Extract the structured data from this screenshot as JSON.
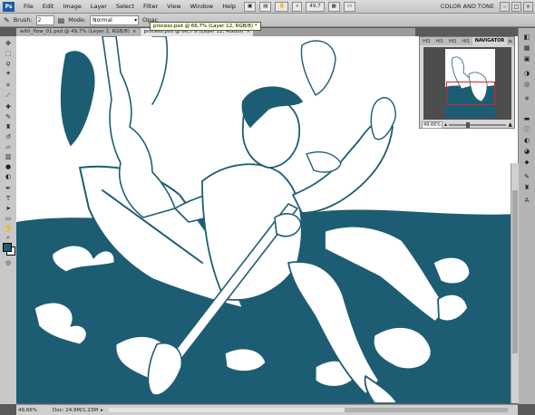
{
  "app": {
    "logo": "Ps"
  },
  "menu": {
    "items": [
      "File",
      "Edit",
      "Image",
      "Layer",
      "Select",
      "Filter",
      "View",
      "Window",
      "Help"
    ],
    "zoom_level": "49,7",
    "workspace": "COLOR AND TONE"
  },
  "options": {
    "brush_label": "Brush:",
    "brush_size": "2",
    "mode_label": "Mode:",
    "mode_value": "Normal",
    "opacity_label": "Opac"
  },
  "tabs": [
    {
      "label": "with_flow_01.psd @ 49,7% (Layer 2, RGB/8)"
    },
    {
      "label": "process.psd @ 66,7% (Layer 12, RGB/8)"
    }
  ],
  "tooltip": "process.psd @ 66,7% (Layer 12, RGB/8) *",
  "navigator": {
    "tabs": [
      "HIS",
      "HIS",
      "HIS",
      "HIS",
      "NAVIGATOR"
    ],
    "zoom": "49,66%"
  },
  "status": {
    "zoom": "49,66%",
    "doc": "Doc: 24,9M/1,23M"
  },
  "colors": {
    "foreground": "#1d5d73",
    "background": "#ffffff",
    "ink": "#1d5d73"
  },
  "icons": {
    "tools": [
      "move-icon",
      "marquee-icon",
      "lasso-icon",
      "magic-wand-icon",
      "crop-icon",
      "eyedropper-icon",
      "healing-icon",
      "brush-icon",
      "clone-stamp-icon",
      "history-brush-icon",
      "eraser-icon",
      "gradient-icon",
      "blur-icon",
      "dodge-icon",
      "pen-icon",
      "type-icon",
      "path-select-icon",
      "shape-icon",
      "3d-rotate-icon",
      "3d-orbit-icon",
      "hand-icon",
      "zoom-icon"
    ]
  }
}
